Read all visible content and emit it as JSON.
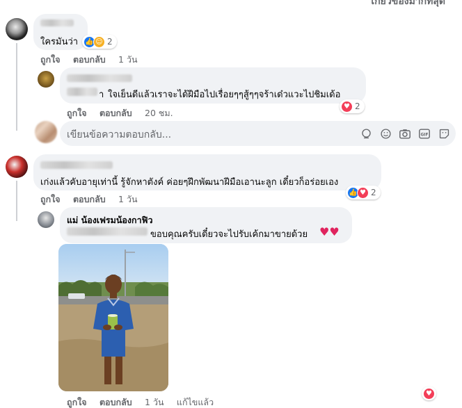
{
  "sort": {
    "label": "เกี่ยวข้องมากที่สุด"
  },
  "comments": [
    {
      "text": "ใครมันว่า",
      "reactions": {
        "icons": [
          "like-icon",
          "care-icon"
        ],
        "count": "2"
      },
      "actions": {
        "like": "ถูกใจ",
        "reply": "ตอบกลับ",
        "time": "1 วัน"
      }
    },
    {
      "text": "ใจเย็นดีแล้วเราจะได้ฝีมือไปเรื่อยๆๆสู้ๆๆจร้าเด๋วแวะไปชิมเด้อ",
      "text_prefix": "า",
      "reactions": {
        "icons": [
          "love-icon"
        ],
        "count": "2"
      },
      "actions": {
        "like": "ถูกใจ",
        "reply": "ตอบกลับ",
        "time": "20 ชม."
      }
    },
    {
      "text": "เก่งแล้วคับอายุเท่านี้ รู้จักหาตังค์ ค่อยๆฝึกพัฒนาฝีมือเอานะลูก เดี๋ยวก็อร่อยเอง",
      "reactions": {
        "icons": [
          "like-icon",
          "love-icon"
        ],
        "count": "2"
      },
      "actions": {
        "like": "ถูกใจ",
        "reply": "ตอบกลับ",
        "time": "1 วัน"
      }
    },
    {
      "author": "แม่ น้องเฟรมน้องกาฟิว",
      "text": "ขอบคุณครับเดี๋ยวจะไปรับเค้กมาขายด้วย",
      "hearts": "♥♥",
      "actions": {
        "like": "ถูกใจ",
        "reply": "ตอบกลับ",
        "time": "1 วัน",
        "edited": "แก้ไขแล้ว"
      }
    }
  ],
  "reply_box": {
    "placeholder": "เขียนข้อความตอบกลับ..."
  },
  "colors": {
    "bubble": "#f0f2f5",
    "link_gray": "#65676b",
    "like_blue": "#1877f2",
    "love_red": "#f33e58"
  }
}
